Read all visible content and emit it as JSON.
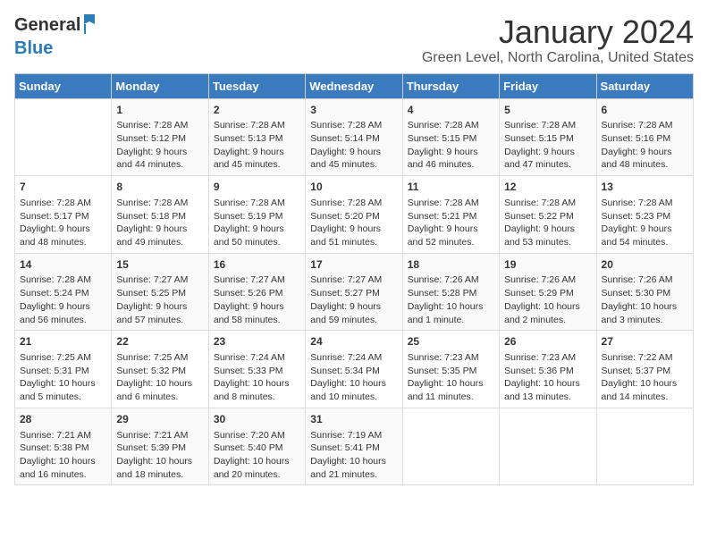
{
  "logo": {
    "general": "General",
    "blue": "Blue"
  },
  "title": "January 2024",
  "location": "Green Level, North Carolina, United States",
  "weekdays": [
    "Sunday",
    "Monday",
    "Tuesday",
    "Wednesday",
    "Thursday",
    "Friday",
    "Saturday"
  ],
  "rows": [
    [
      {
        "day": "",
        "content": ""
      },
      {
        "day": "1",
        "content": "Sunrise: 7:28 AM\nSunset: 5:12 PM\nDaylight: 9 hours\nand 44 minutes."
      },
      {
        "day": "2",
        "content": "Sunrise: 7:28 AM\nSunset: 5:13 PM\nDaylight: 9 hours\nand 45 minutes."
      },
      {
        "day": "3",
        "content": "Sunrise: 7:28 AM\nSunset: 5:14 PM\nDaylight: 9 hours\nand 45 minutes."
      },
      {
        "day": "4",
        "content": "Sunrise: 7:28 AM\nSunset: 5:15 PM\nDaylight: 9 hours\nand 46 minutes."
      },
      {
        "day": "5",
        "content": "Sunrise: 7:28 AM\nSunset: 5:15 PM\nDaylight: 9 hours\nand 47 minutes."
      },
      {
        "day": "6",
        "content": "Sunrise: 7:28 AM\nSunset: 5:16 PM\nDaylight: 9 hours\nand 48 minutes."
      }
    ],
    [
      {
        "day": "7",
        "content": "Sunrise: 7:28 AM\nSunset: 5:17 PM\nDaylight: 9 hours\nand 48 minutes."
      },
      {
        "day": "8",
        "content": "Sunrise: 7:28 AM\nSunset: 5:18 PM\nDaylight: 9 hours\nand 49 minutes."
      },
      {
        "day": "9",
        "content": "Sunrise: 7:28 AM\nSunset: 5:19 PM\nDaylight: 9 hours\nand 50 minutes."
      },
      {
        "day": "10",
        "content": "Sunrise: 7:28 AM\nSunset: 5:20 PM\nDaylight: 9 hours\nand 51 minutes."
      },
      {
        "day": "11",
        "content": "Sunrise: 7:28 AM\nSunset: 5:21 PM\nDaylight: 9 hours\nand 52 minutes."
      },
      {
        "day": "12",
        "content": "Sunrise: 7:28 AM\nSunset: 5:22 PM\nDaylight: 9 hours\nand 53 minutes."
      },
      {
        "day": "13",
        "content": "Sunrise: 7:28 AM\nSunset: 5:23 PM\nDaylight: 9 hours\nand 54 minutes."
      }
    ],
    [
      {
        "day": "14",
        "content": "Sunrise: 7:28 AM\nSunset: 5:24 PM\nDaylight: 9 hours\nand 56 minutes."
      },
      {
        "day": "15",
        "content": "Sunrise: 7:27 AM\nSunset: 5:25 PM\nDaylight: 9 hours\nand 57 minutes."
      },
      {
        "day": "16",
        "content": "Sunrise: 7:27 AM\nSunset: 5:26 PM\nDaylight: 9 hours\nand 58 minutes."
      },
      {
        "day": "17",
        "content": "Sunrise: 7:27 AM\nSunset: 5:27 PM\nDaylight: 9 hours\nand 59 minutes."
      },
      {
        "day": "18",
        "content": "Sunrise: 7:26 AM\nSunset: 5:28 PM\nDaylight: 10 hours\nand 1 minute."
      },
      {
        "day": "19",
        "content": "Sunrise: 7:26 AM\nSunset: 5:29 PM\nDaylight: 10 hours\nand 2 minutes."
      },
      {
        "day": "20",
        "content": "Sunrise: 7:26 AM\nSunset: 5:30 PM\nDaylight: 10 hours\nand 3 minutes."
      }
    ],
    [
      {
        "day": "21",
        "content": "Sunrise: 7:25 AM\nSunset: 5:31 PM\nDaylight: 10 hours\nand 5 minutes."
      },
      {
        "day": "22",
        "content": "Sunrise: 7:25 AM\nSunset: 5:32 PM\nDaylight: 10 hours\nand 6 minutes."
      },
      {
        "day": "23",
        "content": "Sunrise: 7:24 AM\nSunset: 5:33 PM\nDaylight: 10 hours\nand 8 minutes."
      },
      {
        "day": "24",
        "content": "Sunrise: 7:24 AM\nSunset: 5:34 PM\nDaylight: 10 hours\nand 10 minutes."
      },
      {
        "day": "25",
        "content": "Sunrise: 7:23 AM\nSunset: 5:35 PM\nDaylight: 10 hours\nand 11 minutes."
      },
      {
        "day": "26",
        "content": "Sunrise: 7:23 AM\nSunset: 5:36 PM\nDaylight: 10 hours\nand 13 minutes."
      },
      {
        "day": "27",
        "content": "Sunrise: 7:22 AM\nSunset: 5:37 PM\nDaylight: 10 hours\nand 14 minutes."
      }
    ],
    [
      {
        "day": "28",
        "content": "Sunrise: 7:21 AM\nSunset: 5:38 PM\nDaylight: 10 hours\nand 16 minutes."
      },
      {
        "day": "29",
        "content": "Sunrise: 7:21 AM\nSunset: 5:39 PM\nDaylight: 10 hours\nand 18 minutes."
      },
      {
        "day": "30",
        "content": "Sunrise: 7:20 AM\nSunset: 5:40 PM\nDaylight: 10 hours\nand 20 minutes."
      },
      {
        "day": "31",
        "content": "Sunrise: 7:19 AM\nSunset: 5:41 PM\nDaylight: 10 hours\nand 21 minutes."
      },
      {
        "day": "",
        "content": ""
      },
      {
        "day": "",
        "content": ""
      },
      {
        "day": "",
        "content": ""
      }
    ]
  ]
}
